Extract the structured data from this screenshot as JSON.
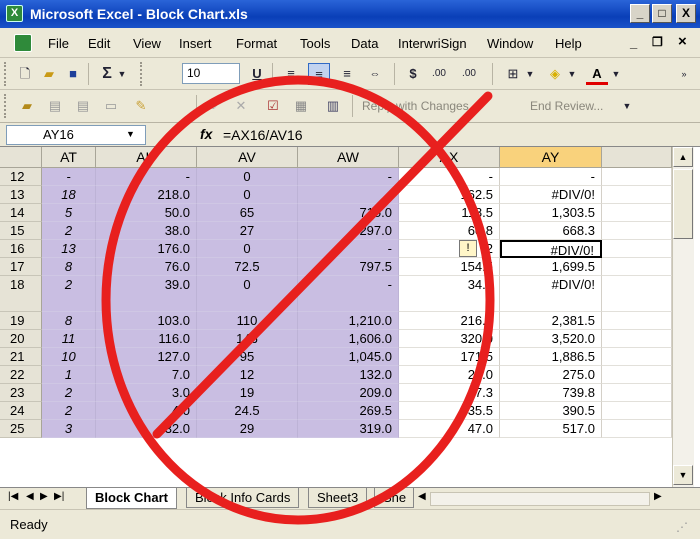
{
  "window": {
    "title": "Microsoft Excel - Block Chart.xls",
    "buttons": {
      "minimize": "_",
      "restore": "□",
      "close": "X"
    }
  },
  "menu": {
    "items": [
      "File",
      "Edit",
      "View",
      "Insert",
      "Format",
      "Tools",
      "Data",
      "InterwriSign",
      "Window",
      "Help"
    ],
    "mdi": {
      "minimize": "_",
      "restore": "ð",
      "close": "×"
    }
  },
  "toolbar1": {
    "sum_label": "Σ",
    "font_size": "10",
    "underline": "U",
    "currency": "$",
    "inc_decimal": ".00",
    "dec_decimal": ".00"
  },
  "toolbar2": {
    "reply_with_changes": "Reply with Changes...",
    "end_review": "End Review..."
  },
  "formula_bar": {
    "name_box": "AY16",
    "fx": "fx",
    "formula": "=AX16/AV16"
  },
  "sheet": {
    "columns": [
      "AT",
      "AU",
      "AV",
      "AW",
      "AX",
      "AY"
    ],
    "rows": [
      {
        "num": "12",
        "cells": [
          "-",
          "-",
          "0",
          "-",
          "-",
          "-"
        ]
      },
      {
        "num": "13",
        "cells": [
          "18",
          "218.0",
          "0",
          "-",
          "162.5",
          "#DIV/0!"
        ]
      },
      {
        "num": "14",
        "cells": [
          "5",
          "50.0",
          "65",
          "715.0",
          "118.5",
          "1,303.5"
        ]
      },
      {
        "num": "15",
        "cells": [
          "2",
          "38.0",
          "27",
          "297.0",
          "60.8",
          "668.3"
        ]
      },
      {
        "num": "16",
        "cells": [
          "13",
          "176.0",
          "0",
          "-",
          "2",
          "#DIV/0!"
        ]
      },
      {
        "num": "17",
        "cells": [
          "8",
          "76.0",
          "72.5",
          "797.5",
          "154.5",
          "1,699.5"
        ]
      },
      {
        "num": "18",
        "cells": [
          "2",
          "39.0",
          "0",
          "-",
          "34.0",
          "#DIV/0!"
        ]
      },
      {
        "num": "19",
        "cells": [
          "8",
          "103.0",
          "110",
          "1,210.0",
          "216.5",
          "2,381.5"
        ]
      },
      {
        "num": "20",
        "cells": [
          "11",
          "116.0",
          "146",
          "1,606.0",
          "320.0",
          "3,520.0"
        ]
      },
      {
        "num": "21",
        "cells": [
          "10",
          "127.0",
          "95",
          "1,045.0",
          "171.5",
          "1,886.5"
        ]
      },
      {
        "num": "22",
        "cells": [
          "1",
          "7.0",
          "12",
          "132.0",
          "25.0",
          "275.0"
        ]
      },
      {
        "num": "23",
        "cells": [
          "2",
          "3.0",
          "19",
          "209.0",
          "67.3",
          "739.8"
        ]
      },
      {
        "num": "24",
        "cells": [
          "2",
          "4.0",
          "24.5",
          "269.5",
          "35.5",
          "390.5"
        ]
      },
      {
        "num": "25",
        "cells": [
          "3",
          "32.0",
          "29",
          "319.0",
          "47.0",
          "517.0"
        ]
      }
    ]
  },
  "sheet_tabs": [
    "Block Chart",
    "Block Info Cards",
    "Sheet3",
    "She"
  ],
  "status": "Ready",
  "colors": {
    "purple_fill": "#c9bee2",
    "overlay_red": "#e8201e"
  }
}
